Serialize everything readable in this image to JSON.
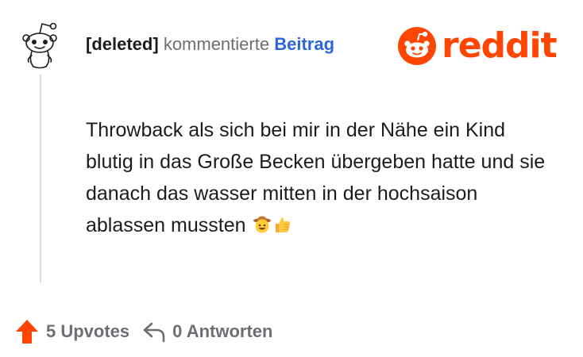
{
  "comment": {
    "author": "[deleted]",
    "action": "kommentierte",
    "target": "Beitrag",
    "body_text": "Throwback als sich bei mir in der Nähe ein Kind blutig in das Große Becken übergeben hatte und sie danach das wasser mitten in der hochsaison ablassen mussten",
    "emojis": [
      "cowboy-face-emoji",
      "thumbs-up-emoji"
    ]
  },
  "brand": {
    "wordmark": "reddit",
    "color": "#ff4500"
  },
  "footer": {
    "upvotes_label": "5 Upvotes",
    "replies_label": "0 Antworten"
  },
  "colors": {
    "link": "#2c67d6",
    "muted": "#6b6f73",
    "text": "#1c1c1c",
    "upvote": "#ff4500"
  }
}
